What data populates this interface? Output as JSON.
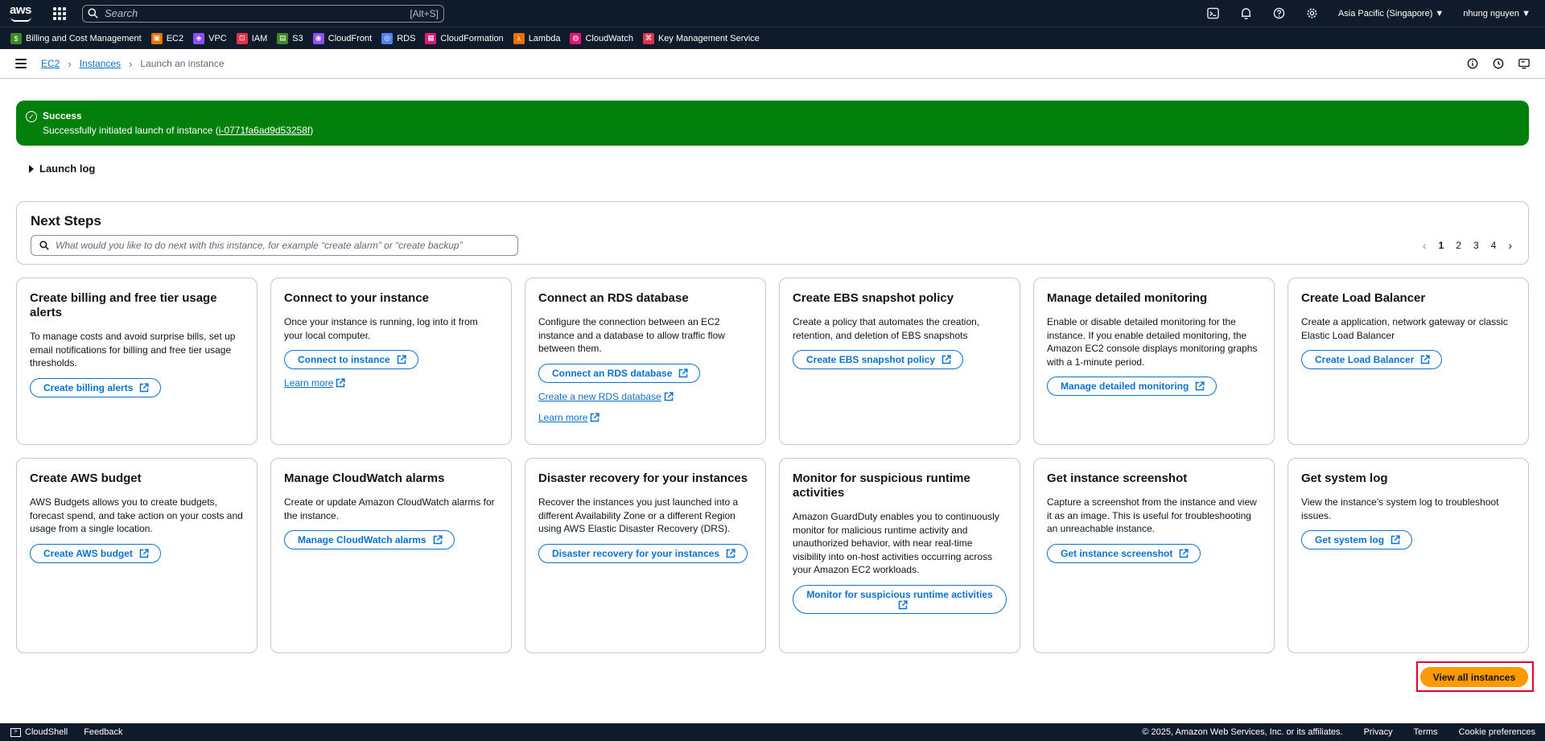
{
  "topnav": {
    "logo": "aws",
    "search_placeholder": "Search",
    "search_shortcut": "[Alt+S]",
    "region": "Asia Pacific (Singapore) ▼",
    "user": "nhung nguyen ▼"
  },
  "favorites": [
    {
      "label": "Billing and Cost Management",
      "color": "#3f8624",
      "glyph": "$"
    },
    {
      "label": "EC2",
      "color": "#ed7100",
      "glyph": "▣"
    },
    {
      "label": "VPC",
      "color": "#8c4fff",
      "glyph": "◈"
    },
    {
      "label": "IAM",
      "color": "#dd344c",
      "glyph": "⊡"
    },
    {
      "label": "S3",
      "color": "#3f8624",
      "glyph": "▤"
    },
    {
      "label": "CloudFront",
      "color": "#8c4fff",
      "glyph": "◉"
    },
    {
      "label": "RDS",
      "color": "#527fff",
      "glyph": "◎"
    },
    {
      "label": "CloudFormation",
      "color": "#e7157b",
      "glyph": "▦"
    },
    {
      "label": "Lambda",
      "color": "#ed7100",
      "glyph": "λ"
    },
    {
      "label": "CloudWatch",
      "color": "#e7157b",
      "glyph": "◍"
    },
    {
      "label": "Key Management Service",
      "color": "#dd344c",
      "glyph": "⌘"
    }
  ],
  "breadcrumb": {
    "ec2": "EC2",
    "instances": "Instances",
    "current": "Launch an instance"
  },
  "banner": {
    "title": "Success",
    "message_prefix": "Successfully initiated launch of instance (",
    "instance_id": "i-0771fa6ad9d53258f",
    "message_suffix": ")"
  },
  "launch_log": "Launch log",
  "next_steps": {
    "title": "Next Steps",
    "search_placeholder": "What would you like to do next with this instance, for example “create alarm” or “create backup”",
    "pages": [
      "1",
      "2",
      "3",
      "4"
    ],
    "active_page": "1"
  },
  "cards": [
    {
      "title": "Create billing and free tier usage alerts",
      "desc": "To manage costs and avoid surprise bills, set up email notifications for billing and free tier usage thresholds.",
      "button": "Create billing alerts",
      "links": []
    },
    {
      "title": "Connect to your instance",
      "desc": "Once your instance is running, log into it from your local computer.",
      "button": "Connect to instance",
      "links": [
        "Learn more"
      ]
    },
    {
      "title": "Connect an RDS database",
      "desc": "Configure the connection between an EC2 instance and a database to allow traffic flow between them.",
      "button": "Connect an RDS database",
      "links": [
        "Create a new RDS database",
        "Learn more"
      ]
    },
    {
      "title": "Create EBS snapshot policy",
      "desc": "Create a policy that automates the creation, retention, and deletion of EBS snapshots",
      "button": "Create EBS snapshot policy",
      "links": []
    },
    {
      "title": "Manage detailed monitoring",
      "desc": "Enable or disable detailed monitoring for the instance. If you enable detailed monitoring, the Amazon EC2 console displays monitoring graphs with a 1-minute period.",
      "button": "Manage detailed monitoring",
      "links": []
    },
    {
      "title": "Create Load Balancer",
      "desc": "Create a application, network gateway or classic Elastic Load Balancer",
      "button": "Create Load Balancer",
      "links": []
    },
    {
      "title": "Create AWS budget",
      "desc": "AWS Budgets allows you to create budgets, forecast spend, and take action on your costs and usage from a single location.",
      "button": "Create AWS budget",
      "links": []
    },
    {
      "title": "Manage CloudWatch alarms",
      "desc": "Create or update Amazon CloudWatch alarms for the instance.",
      "button": "Manage CloudWatch alarms",
      "links": []
    },
    {
      "title": "Disaster recovery for your instances",
      "desc": "Recover the instances you just launched into a different Availability Zone or a different Region using AWS Elastic Disaster Recovery (DRS).",
      "button": "Disaster recovery for your instances",
      "links": []
    },
    {
      "title": "Monitor for suspicious runtime activities",
      "desc": "Amazon GuardDuty enables you to continuously monitor for malicious runtime activity and unauthorized behavior, with near real-time visibility into on-host activities occurring across your Amazon EC2 workloads.",
      "button": "Monitor for suspicious runtime activities",
      "links": []
    },
    {
      "title": "Get instance screenshot",
      "desc": "Capture a screenshot from the instance and view it as an image. This is useful for troubleshooting an unreachable instance.",
      "button": "Get instance screenshot",
      "links": []
    },
    {
      "title": "Get system log",
      "desc": "View the instance's system log to troubleshoot issues.",
      "button": "Get system log",
      "links": []
    }
  ],
  "view_all": "View all instances",
  "footer": {
    "cloudshell": "CloudShell",
    "feedback": "Feedback",
    "copyright": "© 2025, Amazon Web Services, Inc. or its affiliates.",
    "privacy": "Privacy",
    "terms": "Terms",
    "cookies": "Cookie preferences"
  },
  "colors": {
    "nav_bg": "#0f1b2a",
    "success": "#037f0c",
    "link": "#0972d3",
    "primary_button": "#ff9900"
  }
}
